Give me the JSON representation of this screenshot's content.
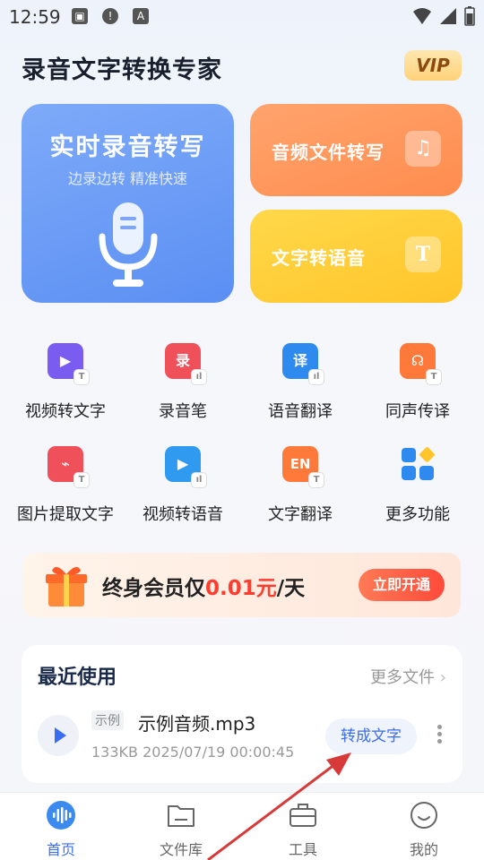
{
  "status_bar": {
    "time": "12:59"
  },
  "header": {
    "title": "录音文字转换专家",
    "vip_label": "VIP"
  },
  "cards": {
    "realtime": {
      "title": "实时录音转写",
      "subtitle": "边录边转 精准快速"
    },
    "audio_file": {
      "label": "音频文件转写",
      "icon": "music-note-icon"
    },
    "tts": {
      "label": "文字转语音",
      "icon": "T"
    }
  },
  "features": [
    {
      "label": "视频转文字",
      "icon_text": "▶",
      "badge": "T",
      "color": "#7b5cf0"
    },
    {
      "label": "录音笔",
      "icon_text": "录",
      "badge": "ıl",
      "color": "#f0505a"
    },
    {
      "label": "语音翻译",
      "icon_text": "译",
      "badge": "ıl",
      "color": "#2f8af0"
    },
    {
      "label": "同声传译",
      "icon_text": "☊",
      "badge": "T",
      "color": "#ff7a3a"
    },
    {
      "label": "图片提取文字",
      "icon_text": "⌁",
      "badge": "T",
      "color": "#f0505a"
    },
    {
      "label": "视频转语音",
      "icon_text": "▶",
      "badge": "ıl",
      "color": "#2f9af0"
    },
    {
      "label": "文字翻译",
      "icon_text": "EN",
      "badge": "T",
      "color": "#ff7a3a"
    },
    {
      "label": "更多功能",
      "icon_text": "",
      "badge": "",
      "color": "#2f8af0"
    }
  ],
  "promo": {
    "prefix": "终身会员仅",
    "price": "0.01元",
    "suffix": "/天",
    "button": "立即开通"
  },
  "recent": {
    "title": "最近使用",
    "more_label": "更多文件",
    "file": {
      "tag": "示例",
      "name": "示例音频.mp3",
      "meta": "133KB 2025/07/19 00:00:45",
      "convert_label": "转成文字"
    }
  },
  "nav": [
    {
      "label": "首页",
      "active": true
    },
    {
      "label": "文件库",
      "active": false
    },
    {
      "label": "工具",
      "active": false
    },
    {
      "label": "我的",
      "active": false
    }
  ],
  "colors": {
    "accent": "#3b6df0",
    "promo_red": "#ff3d2e",
    "annotation_arrow": "#d83a3a"
  }
}
